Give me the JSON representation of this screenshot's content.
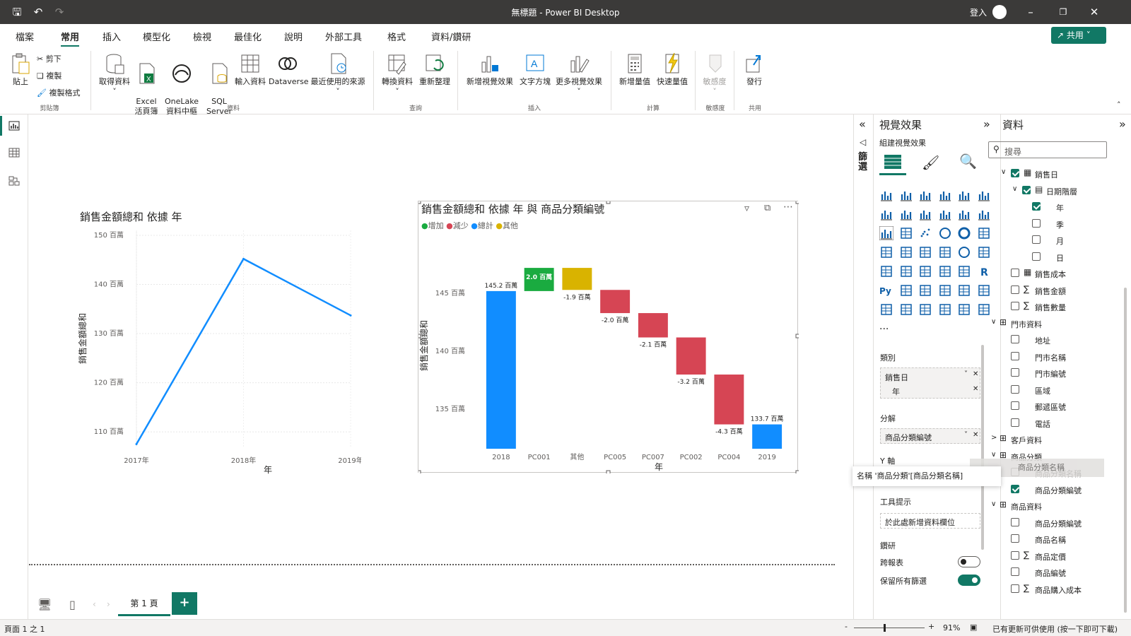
{
  "window": {
    "title": "無標題 - Power BI Desktop",
    "signin": "登入"
  },
  "menu": {
    "tabs": [
      "檔案",
      "常用",
      "插入",
      "模型化",
      "檢視",
      "最佳化",
      "說明",
      "外部工具",
      "格式",
      "資料/鑽研"
    ],
    "share_label": "共用"
  },
  "ribbon": {
    "paste": "貼上",
    "cut": "剪下",
    "copy": "複製",
    "format_painter": "複製格式",
    "get_data": "取得資料",
    "excel": "Excel\n活頁簿",
    "onelake": "OneLake\n資料中樞",
    "sql": "SQL\nServer",
    "enter_data": "輸入資料",
    "dataverse": "Dataverse",
    "recent_sources": "最近使用的來源",
    "transform": "轉換資料",
    "refresh": "重新整理",
    "new_visual": "新增視覺效果",
    "text_box": "文字方塊",
    "more_visuals": "更多視覺效果",
    "new_measure": "新增量值",
    "quick_measure": "快速量值",
    "sensitivity": "敏感度",
    "publish": "發行",
    "groups": {
      "clipboard": "剪貼簿",
      "data": "資料",
      "queries": "查詢",
      "insert": "插入",
      "calc": "計算",
      "sensitivity": "敏感度",
      "share": "共用"
    }
  },
  "line_chart": {
    "title": "銷售金額總和 依據 年",
    "ylabel": "銷售金額總和",
    "xlabel": "年",
    "yticks": [
      "150 百萬",
      "140 百萬",
      "130 百萬",
      "120 百萬",
      "110 百萬"
    ],
    "xticks": [
      "2017年",
      "2018年",
      "2019年"
    ]
  },
  "waterfall_chart": {
    "title": "銷售金額總和 依據 年 與 商品分類編號",
    "legend": [
      {
        "label": "增加",
        "color": "#1aab40"
      },
      {
        "label": "減少",
        "color": "#d64554"
      },
      {
        "label": "總計",
        "color": "#118dff"
      },
      {
        "label": "其他",
        "color": "#d9b300"
      }
    ],
    "ylabel": "銷售金額總和",
    "xlabel": "年",
    "yticks": [
      "145 百萬",
      "140 百萬",
      "135 百萬"
    ]
  },
  "chart_data": [
    {
      "type": "line",
      "title": "銷售金額總和 依據 年",
      "xlabel": "年",
      "ylabel": "銷售金額總和",
      "categories": [
        "2017年",
        "2018年",
        "2019年"
      ],
      "values": [
        107.5,
        145.2,
        133.7
      ],
      "ylim": [
        107,
        151
      ],
      "color": "#118dff"
    },
    {
      "type": "bar",
      "subtype": "waterfall",
      "title": "銷售金額總和 依據 年 與 商品分類編號",
      "xlabel": "年",
      "ylabel": "銷售金額總和",
      "categories": [
        "2018",
        "PC001",
        "其他",
        "PC005",
        "PC007",
        "PC002",
        "PC004",
        "2019"
      ],
      "values": [
        145.2,
        2.0,
        -1.9,
        -2.0,
        -2.1,
        -3.2,
        -4.3,
        133.7
      ],
      "labels": [
        "145.2 百萬",
        "2.0 百萬",
        "-1.9 百萬",
        "-2.0 百萬",
        "-2.1 百萬",
        "-3.2 百萬",
        "-4.3 百萬",
        "133.7 百萬"
      ],
      "kinds": [
        "總計",
        "增加",
        "其他",
        "減少",
        "減少",
        "減少",
        "減少",
        "總計"
      ],
      "ylim": [
        131.6,
        149.4
      ]
    }
  ],
  "viz_pane": {
    "title": "視覺效果",
    "subtitle": "組建視覺效果",
    "filters_label": "篩選",
    "category_label": "類別",
    "category_field": "銷售日",
    "category_sub": "年",
    "breakdown_label": "分解",
    "breakdown_field": "商品分類編號",
    "y_label": "Y 軸",
    "tooltip_drag": "名稱  '商品分類'[商品分類名稱]",
    "tooltips_label": "工具提示",
    "tooltips_placeholder": "於此處新增資料欄位",
    "drill_label": "鑽研",
    "cross_report": "跨報表",
    "keep_filters": "保留所有篩選",
    "more": "..."
  },
  "data_pane": {
    "title": "資料",
    "search_placeholder": "搜尋",
    "items": [
      "銷售日",
      "日期階層",
      "年",
      "季",
      "月",
      "日",
      "銷售成本",
      "銷售金額",
      "銷售數量",
      "門市資料",
      "地址",
      "門市名稱",
      "門市編號",
      "區域",
      "郵遞區號",
      "電話",
      "客戶資料",
      "商品分類",
      "商品分類名稱",
      "商品分類編號",
      "商品資料",
      "商品分類編號",
      "商品名稱",
      "商品定價",
      "商品編號",
      "商品購入成本"
    ],
    "drag_ghost": "商品分類名稱"
  },
  "page_bar": {
    "page_tab": "第 1 頁",
    "add": "+"
  },
  "status": {
    "page": "頁面 1 之 1",
    "zoom": "91%",
    "update": "已有更新可供使用 (按一下即可下載)"
  }
}
